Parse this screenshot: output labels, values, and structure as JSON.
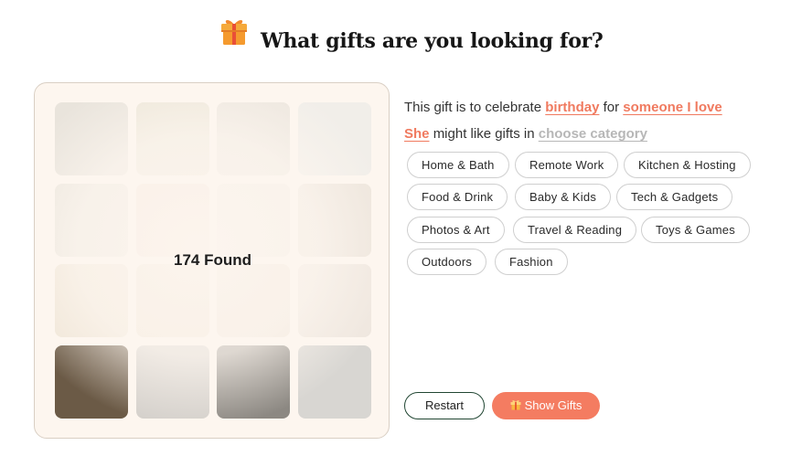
{
  "header": {
    "title": "What gifts are you looking for?",
    "icon": "gift-box-icon"
  },
  "gallery": {
    "found_text": "174 Found",
    "tiles": [
      {
        "name": "wine-glass-holder-tile",
        "bg": "#e9e4dc"
      },
      {
        "name": "candle-jar-tile",
        "bg": "#ece6d8"
      },
      {
        "name": "smart-mug-tile",
        "bg": "#ece6de"
      },
      {
        "name": "leather-bag-tile",
        "bg": "#f1eee9"
      },
      {
        "name": "plant-stand-tile",
        "bg": "#ebe6dd"
      },
      {
        "name": "planter-tile",
        "bg": "#f3e2d8"
      },
      {
        "name": "card-tile",
        "bg": "#f1eae3"
      },
      {
        "name": "bonsai-kit-tile",
        "bg": "#ede5dc"
      },
      {
        "name": "desk-decor-tile",
        "bg": "#efe5d6"
      },
      {
        "name": "wood-tray-tile",
        "bg": "#efe4d6"
      },
      {
        "name": "gift-tag-tile",
        "bg": "#efe5da"
      },
      {
        "name": "keys-charms-tile",
        "bg": "#efe7df"
      },
      {
        "name": "book-lamp-tile",
        "bg": "#6b5a46"
      },
      {
        "name": "scarf-tile",
        "bg": "#d4d0cb"
      },
      {
        "name": "board-game-tile",
        "bg": "#8c8882"
      },
      {
        "name": "tea-tins-tile",
        "bg": "#d8d6d2"
      }
    ]
  },
  "sentence": {
    "line1_prefix": "This gift is to celebrate",
    "occasion": "birthday",
    "line1_mid": "for",
    "recipient": "someone I love",
    "pronoun": "She",
    "line2_mid": "might like gifts in",
    "category": "choose category"
  },
  "categories": [
    "Home & Bath",
    "Remote Work",
    "Kitchen & Hosting",
    "Food & Drink",
    "Baby & Kids",
    "Tech & Gadgets",
    "Photos & Art",
    "Travel & Reading",
    "Toys & Games",
    "Outdoors",
    "Fashion"
  ],
  "buttons": {
    "restart": "Restart",
    "show_gifts": "Show Gifts",
    "show_gifts_icon": "gift-icon"
  },
  "colors": {
    "accent": "#f47c61",
    "link": "#f07a5f",
    "restart_border": "#214633",
    "inactive_link": "#b7b7b7"
  }
}
